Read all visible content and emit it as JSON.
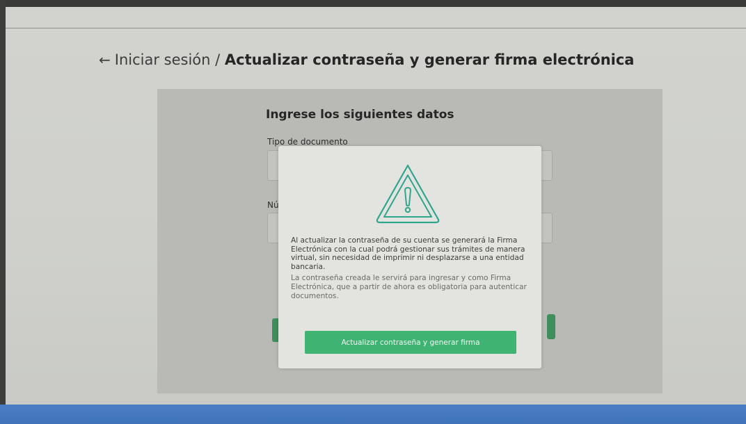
{
  "header": {
    "back_arrow": "←",
    "breadcrumb_parent": "Iniciar sesión /",
    "breadcrumb_current": "Actualizar contraseña y generar firma electrónica"
  },
  "form": {
    "title": "Ingrese los siguientes datos",
    "document_type_label": "Tipo de documento",
    "number_label_partial": "Nú"
  },
  "modal": {
    "icon": "warning-triangle-icon",
    "paragraph_1": "Al actualizar la contraseña de su cuenta se generará la Firma Electrónica con la cual podrá gestionar sus trámites de manera virtual, sin necesidad de imprimir ni desplazarse a una entidad bancaria.",
    "paragraph_2": "La contraseña creada le servirá para ingresar y como Firma Electrónica, que a partir de ahora es obligatoria para autenticar documentos.",
    "button_label": "Actualizar contraseña y generar firma"
  },
  "colors": {
    "primary_green": "#3fb372",
    "icon_teal": "#2fa58d",
    "footer_blue": "#4478bf"
  }
}
